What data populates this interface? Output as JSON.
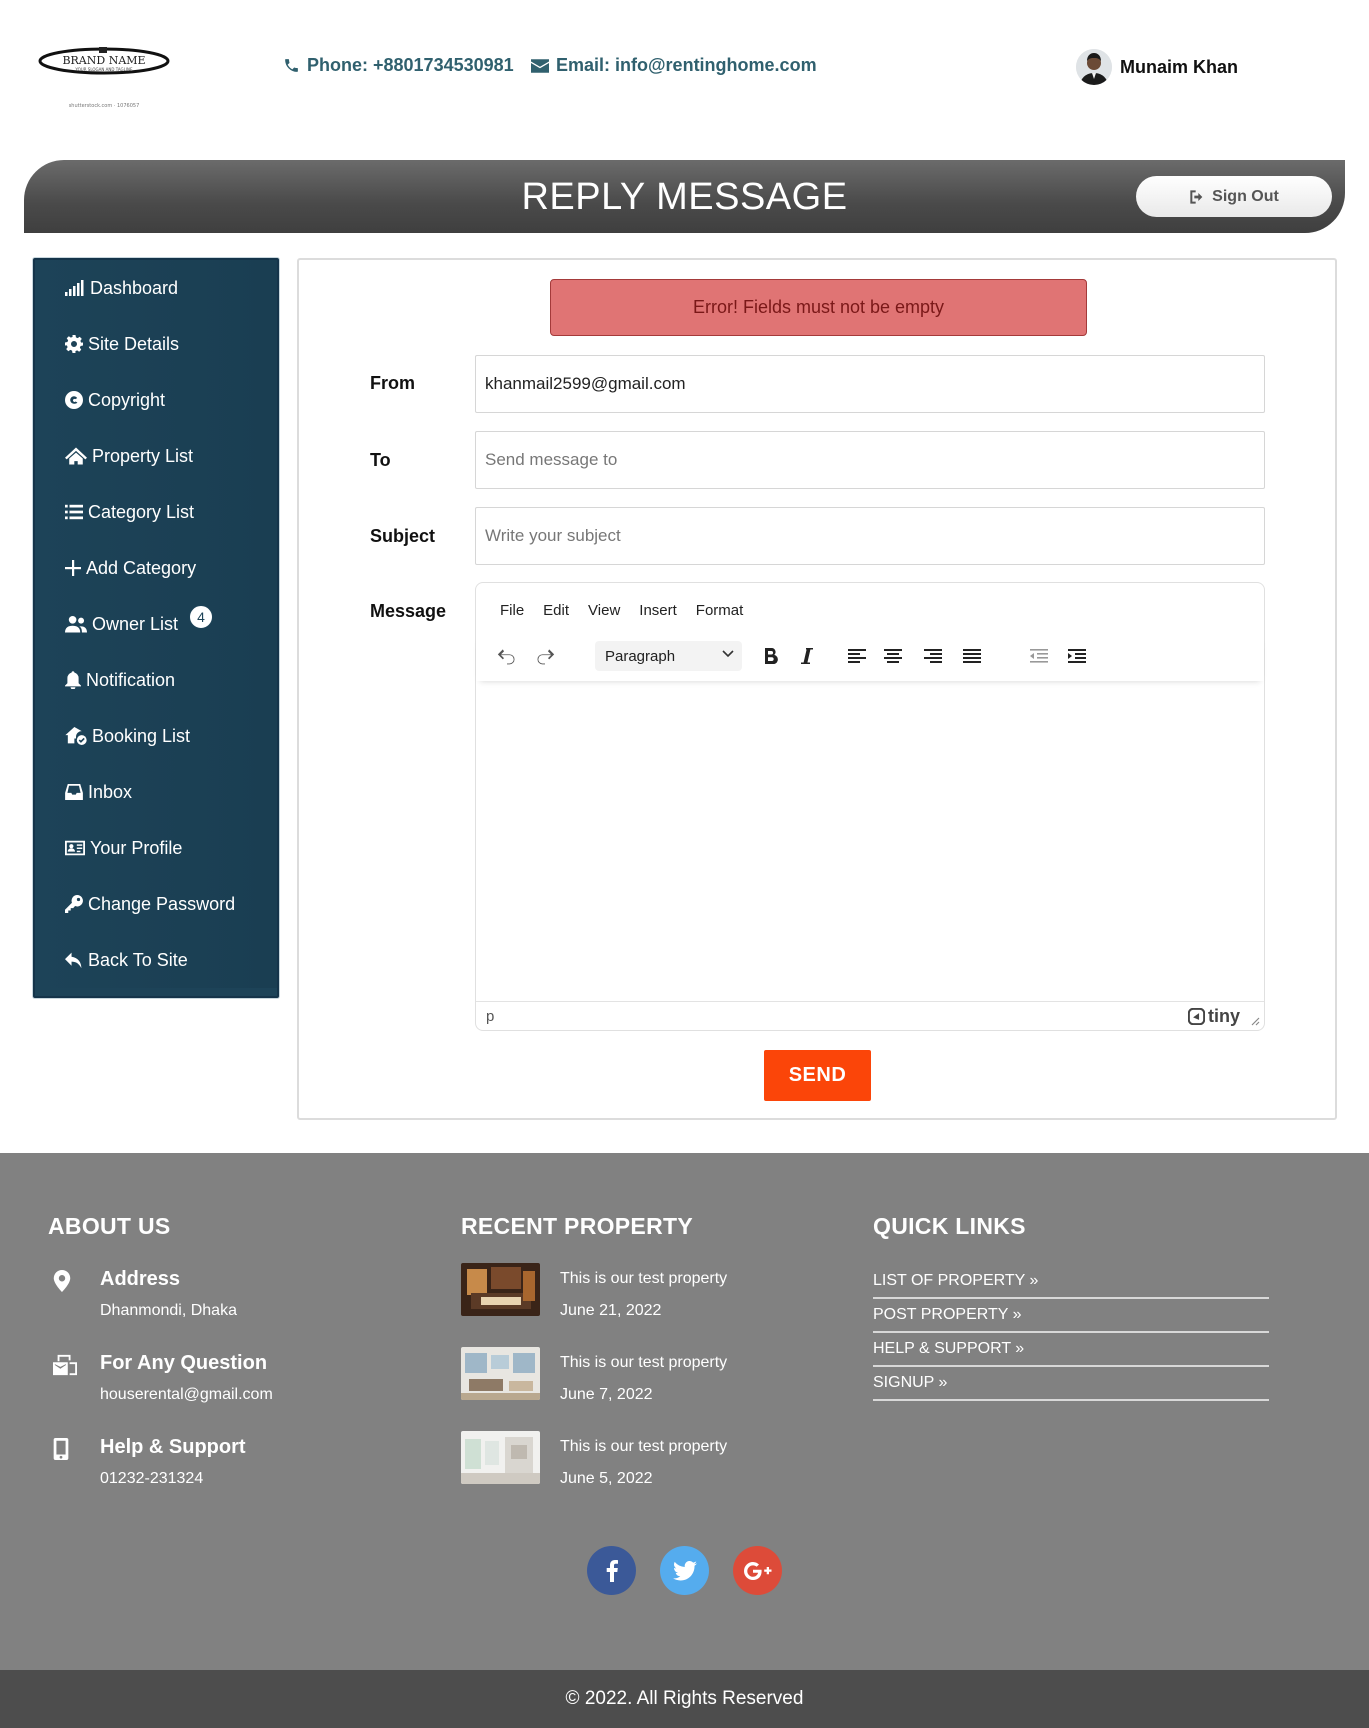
{
  "header": {
    "logo": {
      "text": "BRAND NAME",
      "tagline": "YOUR SLOGAN AND TAGLINE",
      "url_text": "shutterstock.com · 1076057"
    },
    "phone": "Phone: +8801734530981",
    "email": "Email: info@rentinghome.com",
    "user_name": "Munaim Khan"
  },
  "banner": {
    "title": "REPLY MESSAGE",
    "signout_label": "Sign Out"
  },
  "sidebar": {
    "items": [
      {
        "label": "Dashboard",
        "icon": "signal-bars-icon"
      },
      {
        "label": "Site Details",
        "icon": "gear-icon"
      },
      {
        "label": "Copyright",
        "icon": "copyright-icon"
      },
      {
        "label": "Property List",
        "icon": "house-roof-icon"
      },
      {
        "label": "Category List",
        "icon": "list-icon"
      },
      {
        "label": "Add Category",
        "icon": "plus-icon"
      },
      {
        "label": "Owner List",
        "icon": "users-icon",
        "badge": "4"
      },
      {
        "label": "Notification",
        "icon": "bell-icon"
      },
      {
        "label": "Booking List",
        "icon": "house-check-icon"
      },
      {
        "label": "Inbox",
        "icon": "inbox-icon"
      },
      {
        "label": "Your Profile",
        "icon": "id-card-icon"
      },
      {
        "label": "Change Password",
        "icon": "key-icon"
      },
      {
        "label": "Back To Site",
        "icon": "back-arrow-icon"
      }
    ]
  },
  "form": {
    "error": "Error! Fields must not be empty",
    "from": {
      "label": "From",
      "value": "khanmail2599@gmail.com"
    },
    "to": {
      "label": "To",
      "placeholder": "Send message to"
    },
    "subject": {
      "label": "Subject",
      "placeholder": "Write your subject"
    },
    "message": {
      "label": "Message"
    },
    "editor": {
      "menu": [
        "File",
        "Edit",
        "View",
        "Insert",
        "Format"
      ],
      "block_format": "Paragraph",
      "status_path": "p",
      "brand": "tiny"
    },
    "send_label": "SEND"
  },
  "footer": {
    "about": {
      "heading": "ABOUT US",
      "items": [
        {
          "title": "Address",
          "value": "Dhanmondi, Dhaka",
          "icon": "map-pin-icon"
        },
        {
          "title": "For Any Question",
          "value": "houserental@gmail.com",
          "icon": "mail-bulk-icon"
        },
        {
          "title": "Help & Support",
          "value": "01232-231324",
          "icon": "mobile-icon"
        }
      ]
    },
    "recent": {
      "heading": "RECENT PROPERTY",
      "items": [
        {
          "title": "This is our test property",
          "date": "June 21, 2022"
        },
        {
          "title": "This is our test property",
          "date": "June 7, 2022"
        },
        {
          "title": "This is our test property",
          "date": "June 5, 2022"
        }
      ]
    },
    "links": {
      "heading": "QUICK LINKS",
      "items": [
        "LIST OF PROPERTY »",
        "POST PROPERTY »",
        "HELP & SUPPORT »",
        "SIGNUP »"
      ]
    },
    "social": [
      {
        "name": "facebook",
        "color": "#3b5998"
      },
      {
        "name": "twitter",
        "color": "#55acee"
      },
      {
        "name": "google-plus",
        "color": "#dd4b39"
      }
    ],
    "copyright": "© 2022. All Rights Reserved"
  },
  "colors": {
    "sidebar": "#1d4358",
    "accent_send": "#fb4509",
    "error_bg": "#e07474",
    "footer_bg": "#818181",
    "contact": "#30606e"
  }
}
